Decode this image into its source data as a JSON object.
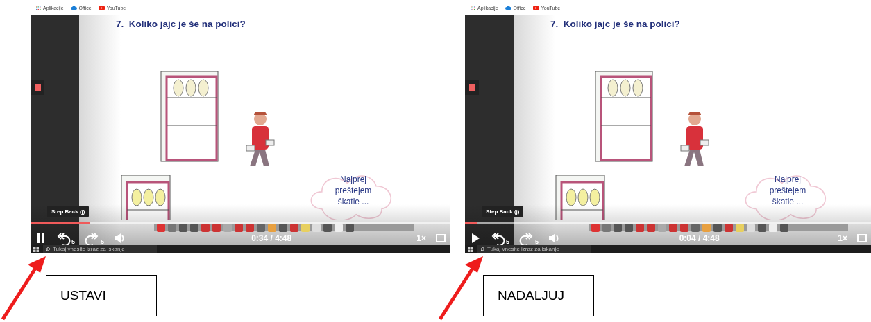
{
  "panels": [
    {
      "bookmarks": [
        {
          "label": "Aplikacije",
          "kind": "apps"
        },
        {
          "label": "Office",
          "kind": "cloud"
        },
        {
          "label": "YouTube",
          "kind": "youtube"
        }
      ],
      "slide_title": "7.  Koliko jajc je še na polici?",
      "bubble_lines": [
        "Najprej",
        "preštejem",
        "škatle ..."
      ],
      "tooltip": "Step Back (j)",
      "playing": true,
      "progress": {
        "level": 0.14
      },
      "skip_back": "5",
      "skip_forward": "5",
      "time": "0:34 / 4:48",
      "speed": "1×",
      "taskbar_search": "Tukaj vnesite izraz za iskanje",
      "caption": "USTAVI"
    },
    {
      "bookmarks": [
        {
          "label": "Aplikacije",
          "kind": "apps"
        },
        {
          "label": "Office",
          "kind": "cloud"
        },
        {
          "label": "YouTube",
          "kind": "youtube"
        }
      ],
      "slide_title": "7.  Koliko jajc je še na polici?",
      "bubble_lines": [
        "Najprej",
        "preštejem",
        "škatle ..."
      ],
      "tooltip": "Step Back (j)",
      "playing": false,
      "progress": {
        "level": 0.03
      },
      "skip_back": "5",
      "skip_forward": "5",
      "time": "0:04 / 4:48",
      "speed": "1×",
      "taskbar_search": "Tukaj vnesite izraz za iskanje",
      "caption": "NADALJUJ"
    }
  ]
}
